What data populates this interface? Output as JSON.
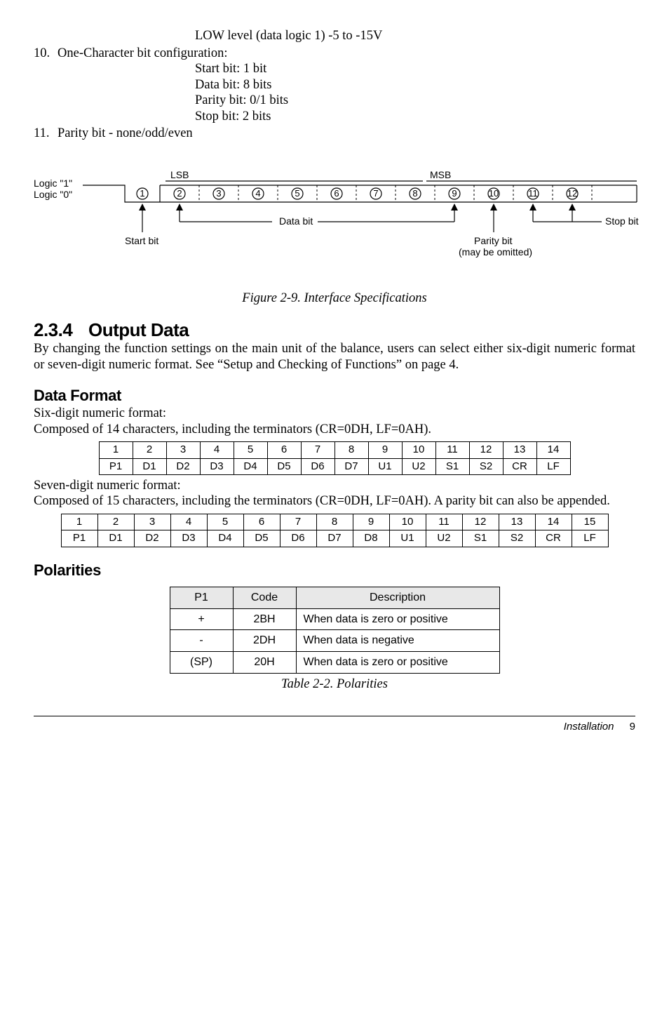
{
  "top": {
    "low_level": "LOW level (data logic 1) -5 to -15V",
    "item10_num": "10.",
    "item10_text": "One-Character bit configuration:",
    "start_bit": "Start bit: 1 bit",
    "data_bit": "Data bit: 8 bits",
    "parity_bit": "Parity bit: 0/1 bits",
    "stop_bit": "Stop bit: 2 bits",
    "item11_num": "11.",
    "item11_text": "Parity bit - none/odd/even"
  },
  "figure": {
    "logic1": "Logic \"1\"",
    "logic0": "Logic \"0\"",
    "lsb": "LSB",
    "msb": "MSB",
    "databit": "Data bit",
    "startbit": "Start bit",
    "paritybit": "Parity bit",
    "omitted": "(may be omitted)",
    "stopbit": "Stop bit",
    "caption": "Figure 2-9. Interface Specifications"
  },
  "sec": {
    "num": "2.3.4",
    "title": "Output Data",
    "para": "By changing the function settings on the main unit of the balance, users can select either six-digit numeric format or seven-digit numeric format. See “Setup and Checking of Functions” on page 4."
  },
  "df": {
    "heading": "Data Format",
    "six_label": "Six-digit numeric format:",
    "six_desc": "Composed of 14 characters, including the terminators (CR=0DH, LF=0AH).",
    "seven_label": "Seven-digit numeric format:",
    "seven_desc": "Composed of 15 characters, including the terminators (CR=0DH, LF=0AH). A parity bit can also be appended."
  },
  "table14": {
    "head": [
      "1",
      "2",
      "3",
      "4",
      "5",
      "6",
      "7",
      "8",
      "9",
      "10",
      "11",
      "12",
      "13",
      "14"
    ],
    "row": [
      "P1",
      "D1",
      "D2",
      "D3",
      "D4",
      "D5",
      "D6",
      "D7",
      "U1",
      "U2",
      "S1",
      "S2",
      "CR",
      "LF"
    ]
  },
  "table15": {
    "head": [
      "1",
      "2",
      "3",
      "4",
      "5",
      "6",
      "7",
      "8",
      "9",
      "10",
      "11",
      "12",
      "13",
      "14",
      "15"
    ],
    "row": [
      "P1",
      "D1",
      "D2",
      "D3",
      "D4",
      "D5",
      "D6",
      "D7",
      "D8",
      "U1",
      "U2",
      "S1",
      "S2",
      "CR",
      "LF"
    ]
  },
  "pol": {
    "heading": "Polarities",
    "headers": [
      "P1",
      "Code",
      "Description"
    ],
    "rows": [
      {
        "p1": "+",
        "code": "2BH",
        "desc": "When data is zero or positive"
      },
      {
        "p1": "-",
        "code": "2DH",
        "desc": "When data is negative"
      },
      {
        "p1": "(SP)",
        "code": "20H",
        "desc": "When data is zero or positive"
      }
    ],
    "caption": "Table 2-2. Polarities"
  },
  "footer": {
    "section": "Installation",
    "page": "9"
  }
}
